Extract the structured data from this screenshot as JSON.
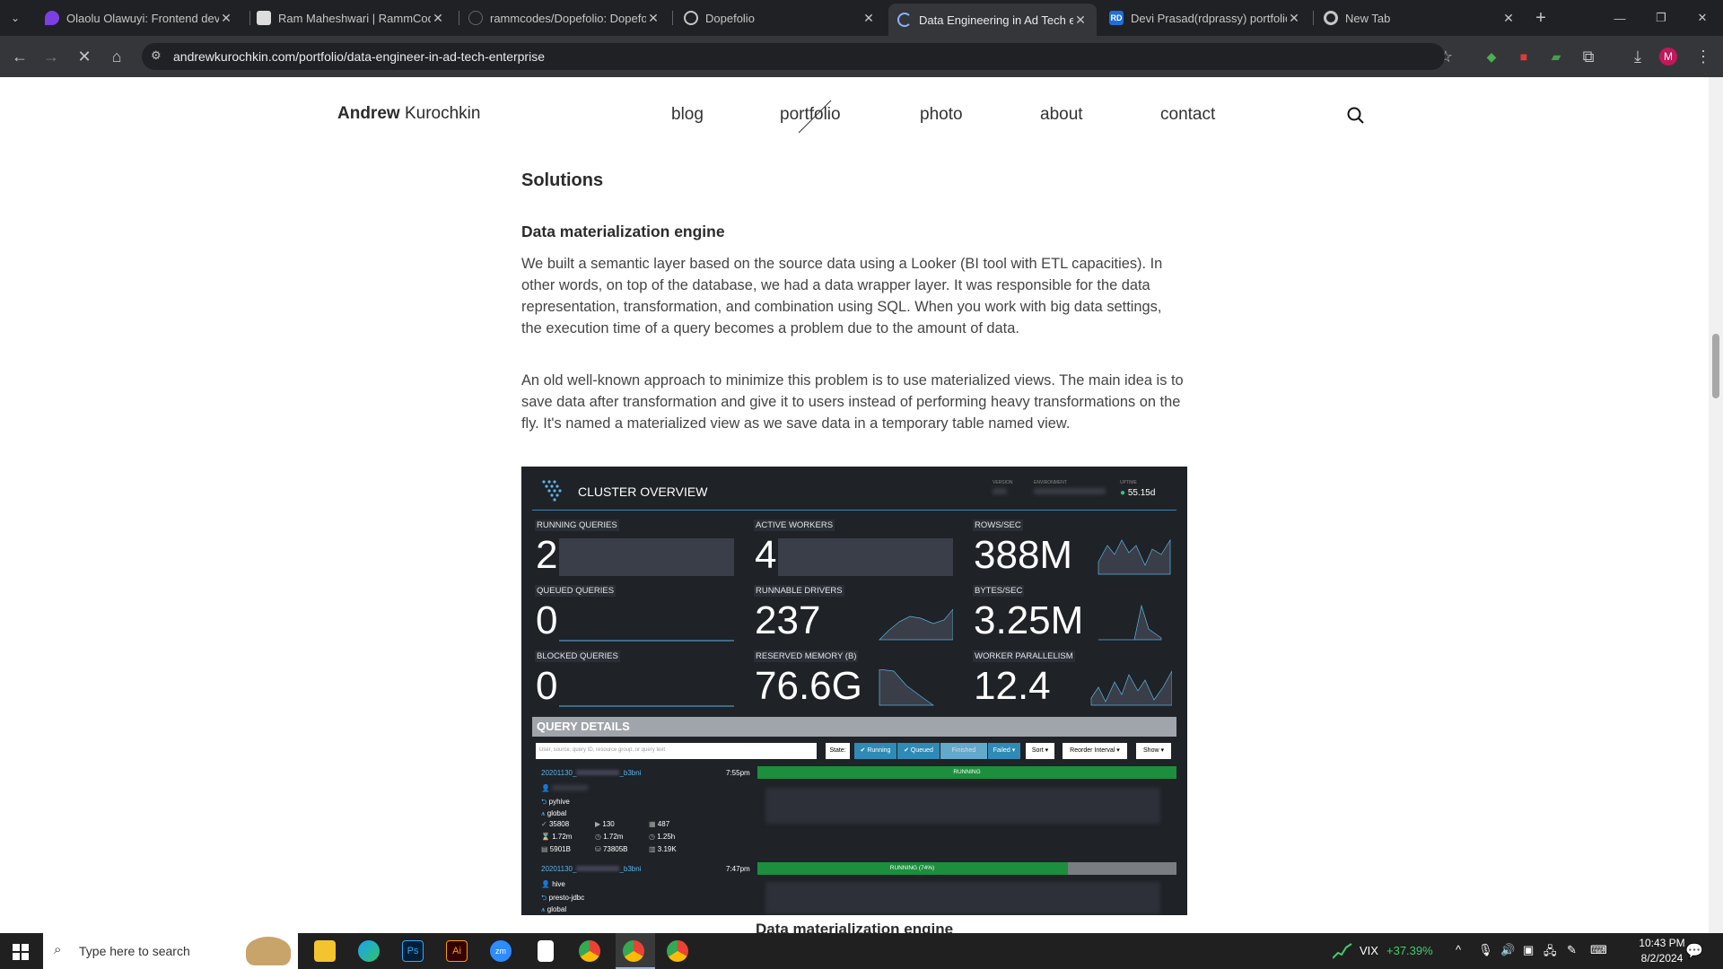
{
  "browser": {
    "tabs": [
      {
        "title": "Olaolu Olawuyi: Frontend deve",
        "icon": "purple-pin-icon"
      },
      {
        "title": "Ram Maheshwari | RammCode",
        "icon": "profile-photo-icon"
      },
      {
        "title": "rammcodes/Dopefolio: Dopefo",
        "icon": "github-icon"
      },
      {
        "title": "Dopefolio",
        "icon": "globe-icon"
      },
      {
        "title": "Data Engineering in Ad Tech en",
        "icon": "loading-icon"
      },
      {
        "title": "Devi Prasad(rdprassy) portfolio",
        "icon": "rd-logo-icon"
      },
      {
        "title": "New Tab",
        "icon": "chrome-icon"
      }
    ],
    "url": "andrewkurochkin.com/portfolio/data-engineer-in-ad-tech-enterprise",
    "profile_initial": "M"
  },
  "site": {
    "brand_first": "Andrew",
    "brand_last": "Kurochkin",
    "nav": [
      "blog",
      "portfolio",
      "photo",
      "about",
      "contact"
    ]
  },
  "article": {
    "section_title": "Solutions",
    "subsection_title": "Data materialization engine",
    "paragraph1": "We built a semantic layer based on the source data using a Looker (BI tool with ETL capacities). In other words, on top of the database, we had a data wrapper layer. It was responsible for the data representation, transformation, and combination using SQL. When you work with big data settings, the execution time of a query becomes a problem due to the amount of data.",
    "paragraph2": "An old well-known approach to minimize this problem is to use materialized views. The main idea is to save data after transformation and give it to users instead of performing heavy transformations on the fly. It's named a materialized view as we save data in a temporary table named view.",
    "figure_caption": "Data materialization engine"
  },
  "dashboard": {
    "title": "CLUSTER OVERVIEW",
    "meta": {
      "version_label": "VERSION",
      "environment_label": "ENVIRONMENT",
      "uptime_label": "UPTIME",
      "uptime": "55.15d"
    },
    "metrics": [
      {
        "label": "RUNNING QUERIES",
        "value": "2"
      },
      {
        "label": "ACTIVE WORKERS",
        "value": "4"
      },
      {
        "label": "ROWS/SEC",
        "value": "388M"
      },
      {
        "label": "QUEUED QUERIES",
        "value": "0"
      },
      {
        "label": "RUNNABLE DRIVERS",
        "value": "237"
      },
      {
        "label": "BYTES/SEC",
        "value": "3.25M"
      },
      {
        "label": "BLOCKED QUERIES",
        "value": "0"
      },
      {
        "label": "RESERVED MEMORY (B)",
        "value": "76.6G"
      },
      {
        "label": "WORKER PARALLELISM",
        "value": "12.4"
      }
    ],
    "query_details_title": "QUERY DETAILS",
    "search_placeholder": "User, source, query ID, resource group, or query text",
    "filters": {
      "state": "State:",
      "running": "✔ Running",
      "queued": "✔ Queued",
      "finished": "Finished",
      "failed": "Failed ▾",
      "sort": "Sort ▾",
      "reorder": "Reorder Interval ▾",
      "show": "Show ▾"
    },
    "queries": [
      {
        "id_prefix": "20201130_",
        "id_suffix": "_b3bni",
        "time": "7:55pm",
        "status": "RUNNING",
        "progress": 1.0,
        "source": "pyhive",
        "group": "global",
        "stats": [
          "35808",
          "130",
          "487",
          "1.72m",
          "1.72m",
          "1.25h",
          "5901B",
          "73805B",
          "3.19K"
        ]
      },
      {
        "id_prefix": "20201130_",
        "id_suffix": "_b3bni",
        "time": "7:47pm",
        "status": "RUNNING (74%)",
        "progress": 0.74,
        "user": "hive",
        "source": "presto-jdbc",
        "group": "global"
      }
    ]
  },
  "taskbar": {
    "search_placeholder": "Type here to search",
    "ticker": "VIX",
    "ticker_change": "+37.39%",
    "time": "10:43 PM",
    "date": "8/2/2024"
  }
}
